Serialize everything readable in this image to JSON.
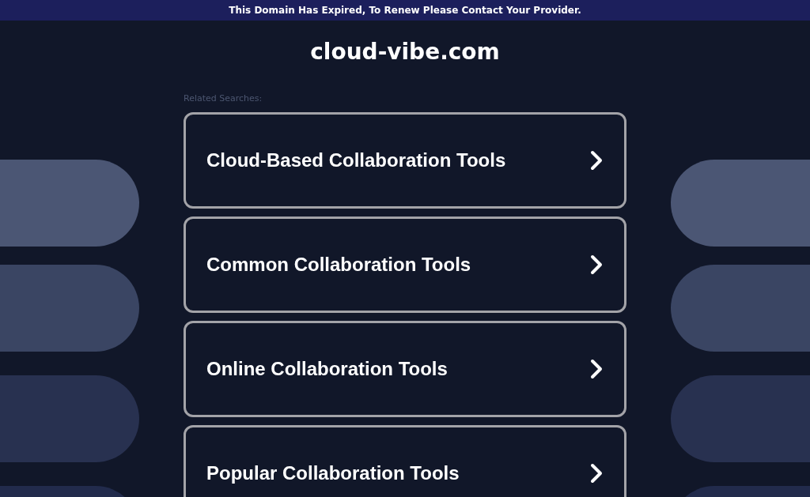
{
  "banner": {
    "text": "This Domain Has Expired, To Renew Please Contact Your Provider."
  },
  "domain": "cloud-vibe.com",
  "related_label": "Related Searches:",
  "searches": [
    {
      "label": "Cloud-Based Collaboration Tools"
    },
    {
      "label": "Common Collaboration Tools"
    },
    {
      "label": "Online Collaboration Tools"
    },
    {
      "label": "Popular Collaboration Tools"
    }
  ]
}
